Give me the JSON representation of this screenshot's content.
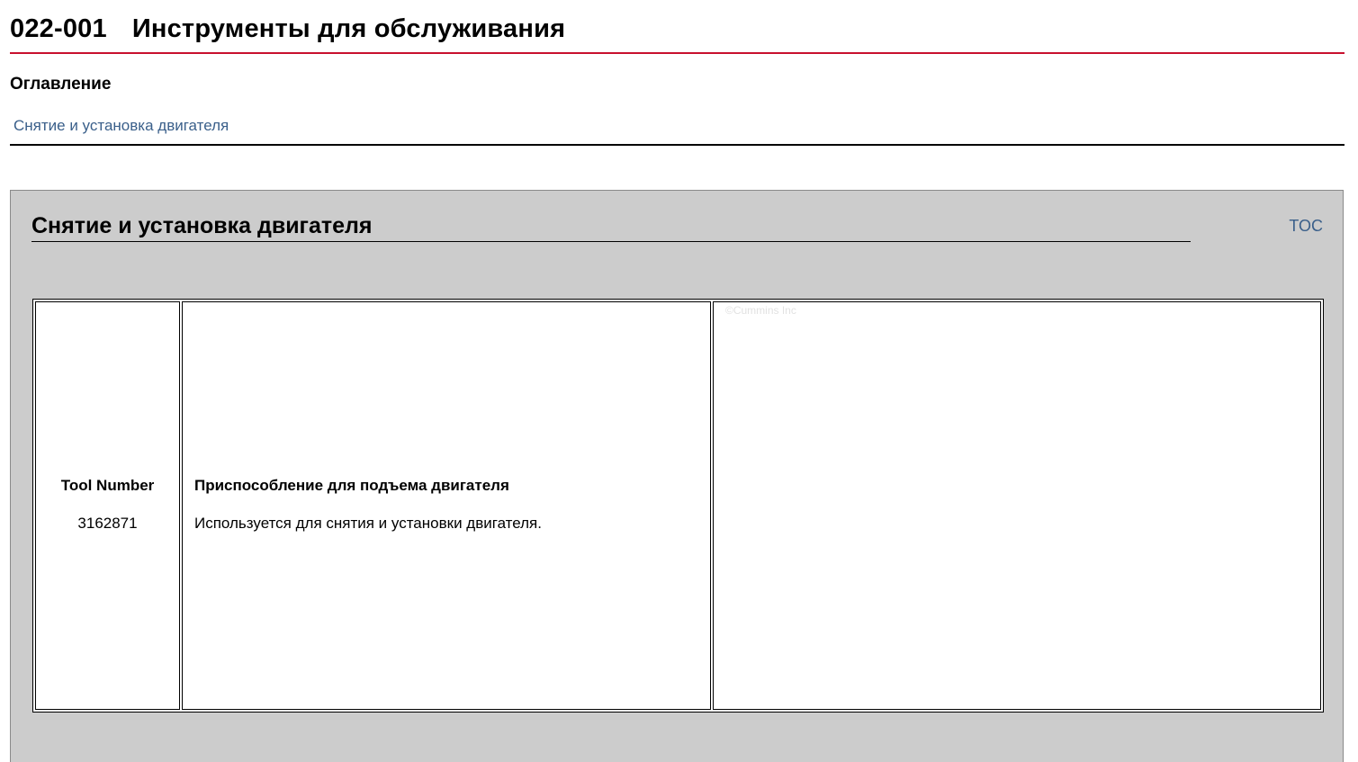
{
  "header": {
    "code": "022-001",
    "title": "Инструменты для обслуживания"
  },
  "toc": {
    "heading": "Оглавление",
    "links": [
      {
        "label": "Снятие и установка двигателя"
      }
    ]
  },
  "section": {
    "title": "Снятие и установка двигателя",
    "toc_link_label": "TOC",
    "tool": {
      "number_label": "Tool Number",
      "number_value": "3162871",
      "name": "Приспособление для подъема двигателя",
      "usage": "Используется для снятия и установки двигателя.",
      "image_watermark": "©Cummins Inc"
    }
  },
  "colors": {
    "header_rule": "#c8102e",
    "link": "#3a5f8a",
    "panel_background": "#cccccc"
  }
}
